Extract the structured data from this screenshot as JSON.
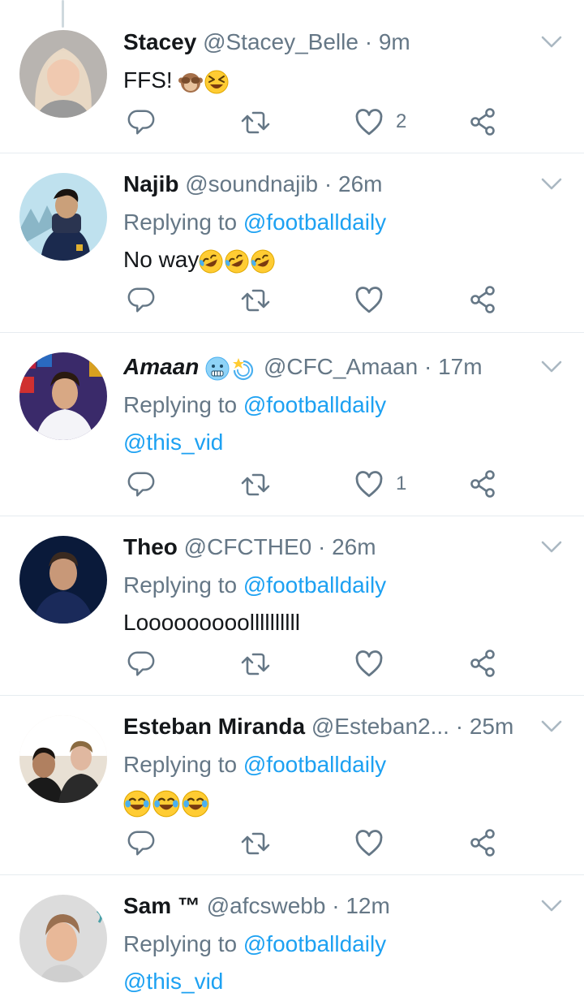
{
  "tweets": [
    {
      "name": "Stacey",
      "handle": "@Stacey_Belle",
      "separator": "·",
      "time": "9m",
      "replying_prefix": "",
      "replying_to": "",
      "text": "FFS!",
      "likes": "2"
    },
    {
      "name": "Najib",
      "handle": "@soundnajib",
      "separator": "·",
      "time": "26m",
      "replying_prefix": "Replying to",
      "replying_to": "@footballdaily",
      "text": "No way",
      "likes": ""
    },
    {
      "name": "Amaan",
      "handle": "@CFC_Amaan",
      "separator": "·",
      "time": "17m",
      "replying_prefix": "Replying to",
      "replying_to": "@footballdaily",
      "text": "@this_vid",
      "likes": "1"
    },
    {
      "name": "Theo",
      "handle": "@CFCTHE0",
      "separator": "·",
      "time": "26m",
      "replying_prefix": "Replying to",
      "replying_to": "@footballdaily",
      "text": "Looooooooollllllllll",
      "likes": ""
    },
    {
      "name": "Esteban Miranda",
      "handle": "@Esteban2...",
      "separator": "·",
      "time": "25m",
      "replying_prefix": "Replying to",
      "replying_to": "@footballdaily",
      "text": "",
      "likes": ""
    },
    {
      "name": "Sam ™",
      "handle": "@afcswebb",
      "separator": "·",
      "time": "12m",
      "replying_prefix": "Replying to",
      "replying_to": "@footballdaily",
      "text": "@this_vid",
      "likes": ""
    }
  ],
  "colors": {
    "accent": "#1da1f2",
    "secondary_text": "#657786",
    "divider": "#e6ecf0"
  },
  "icons": {
    "reply": "reply-icon",
    "retweet": "retweet-icon",
    "like": "heart-icon",
    "share": "share-icon",
    "more": "chevron-down-icon"
  }
}
